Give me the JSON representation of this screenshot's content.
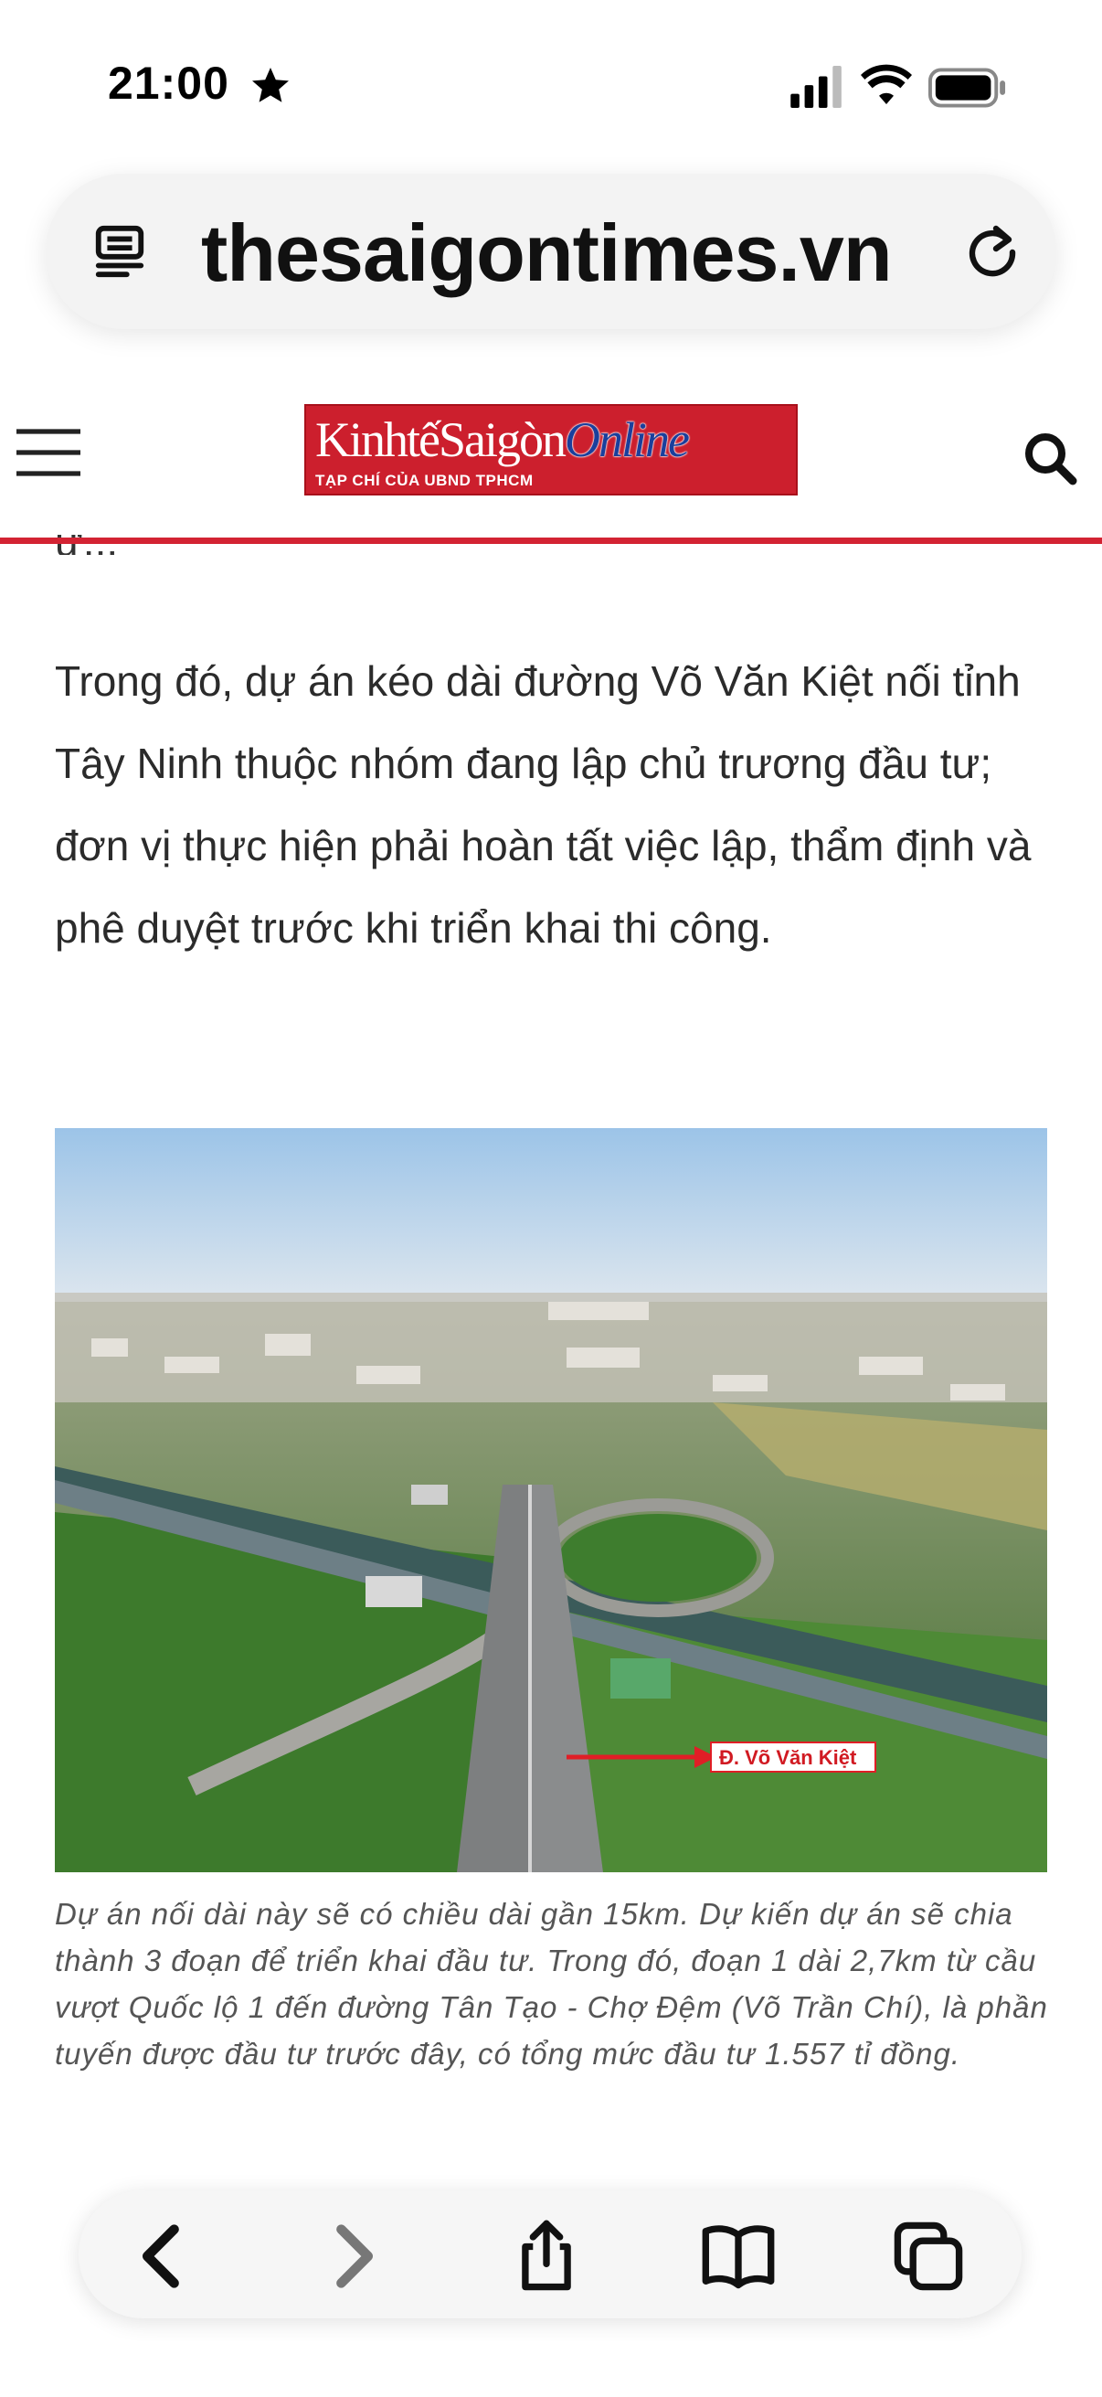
{
  "status_bar": {
    "time": "21:00",
    "icons": [
      "star-icon",
      "cellular-signal-icon",
      "wifi-icon",
      "battery-icon"
    ]
  },
  "browser": {
    "url": "thesaigontimes.vn",
    "left_icon": "reader-mode-icon",
    "right_icon": "reload-icon"
  },
  "site_header": {
    "logo_kinhte": "KinhtếSaigòn",
    "logo_online": "Online",
    "logo_subtitle": "TẠP CHÍ CỦA UBND TPHCM",
    "left_icon": "hamburger-menu-icon",
    "right_icon": "search-icon",
    "accent_color": "#d32333"
  },
  "article": {
    "partial_text": "ư...",
    "paragraph": "Trong đó, dự án kéo dài đường Võ Văn Kiệt nối tỉnh Tây Ninh thuộc nhóm đang lập chủ trương đầu tư; đơn vị thực hiện phải hoàn tất việc lập, thẩm định và phê duyệt trước khi triển khai thi công.",
    "photo_label": "Đ. Võ Văn Kiệt",
    "caption": "Dự án nối dài này sẽ có chiều dài gần 15km. Dự kiến dự án sẽ chia thành 3 đoạn để triển khai đầu tư. Trong đó, đoạn 1 dài 2,7km từ cầu vượt Quốc lộ 1 đến đường Tân Tạo - Chợ Đệm (Võ Trần Chí), là phần tuyến được đầu tư trước đây, có tổng mức đầu tư 1.557 tỉ đồng."
  },
  "toolbar": {
    "buttons": [
      "back-icon",
      "forward-icon",
      "share-icon",
      "bookmarks-icon",
      "tabs-icon"
    ]
  }
}
